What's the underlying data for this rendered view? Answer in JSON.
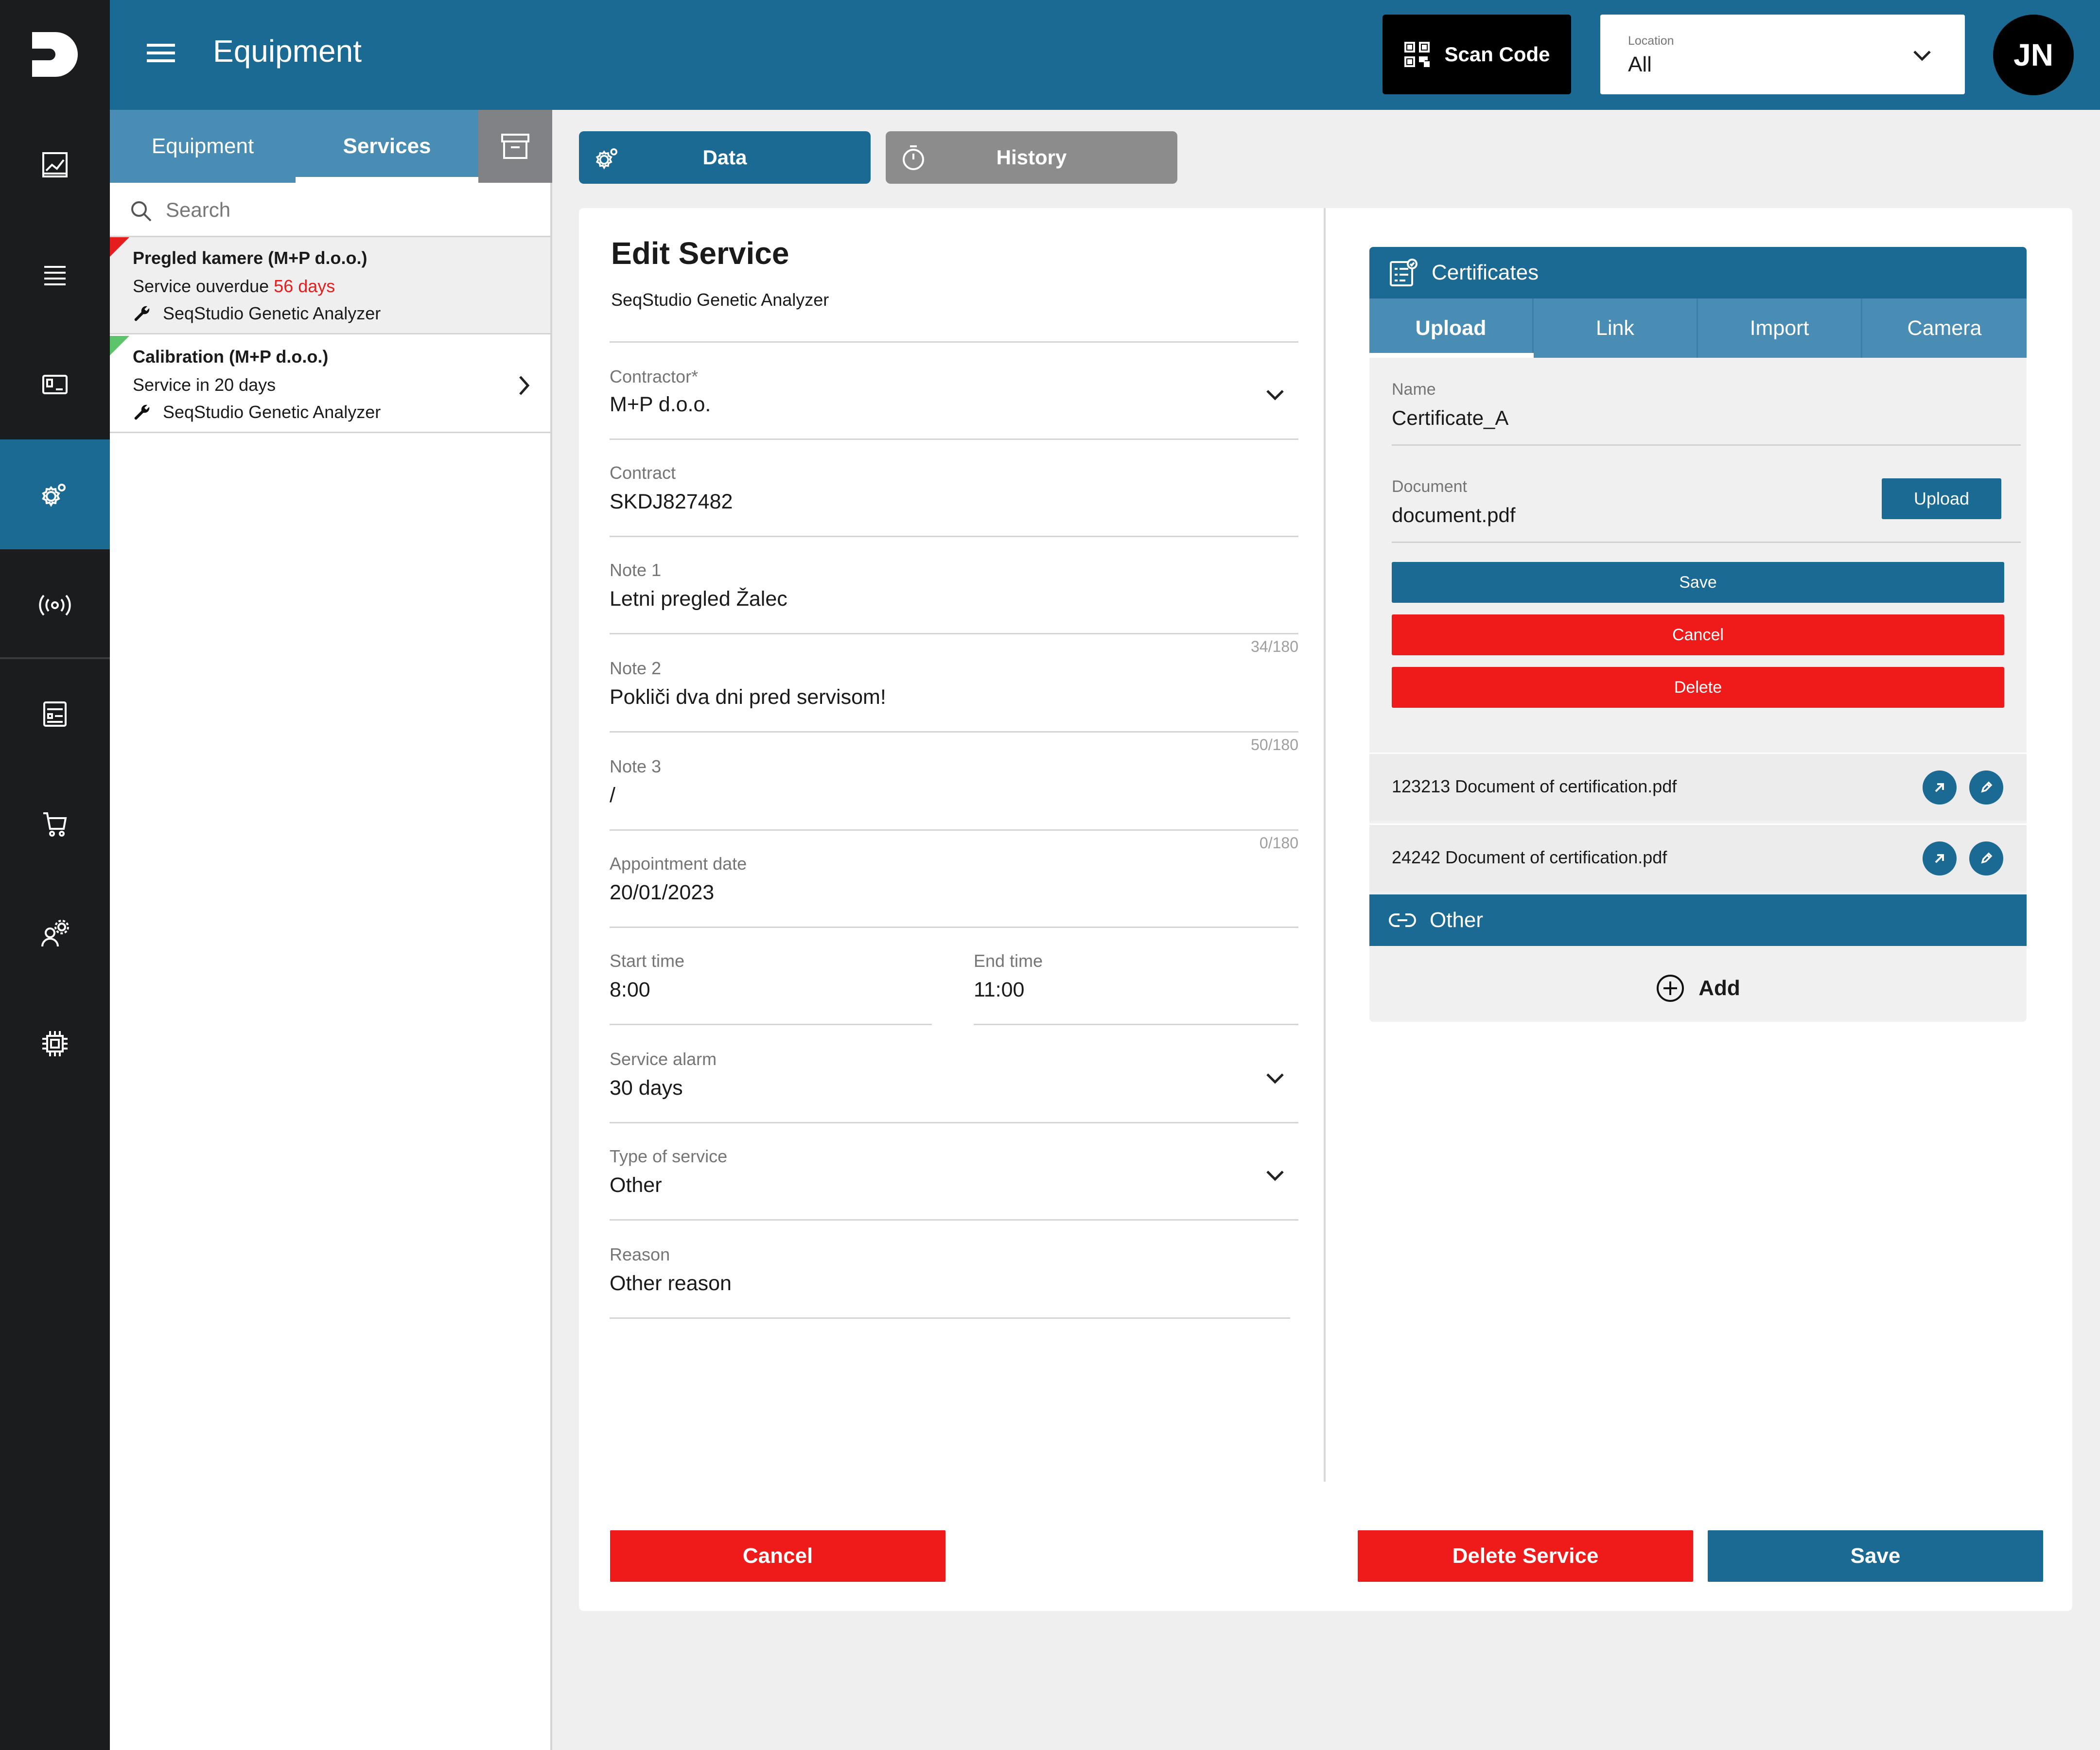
{
  "header": {
    "title": "Equipment",
    "scan_label": "Scan Code",
    "location_label": "Location",
    "location_value": "All",
    "avatar_initials": "JN"
  },
  "list": {
    "tabs": [
      "Equipment",
      "Services"
    ],
    "active_tab": "Services",
    "search_placeholder": "Search",
    "items": [
      {
        "title": "Pregled kamere (M+P d.o.o.)",
        "status_prefix": "Service ouverdue ",
        "status_highlight": "56 days",
        "device": "SeqStudio Genetic Analyzer",
        "corner_color": "#e51d1d"
      },
      {
        "title": "Calibration (M+P d.o.o.)",
        "status_prefix": "Service in 20 days",
        "status_highlight": "",
        "device": "SeqStudio Genetic Analyzer",
        "corner_color": "#5cc46a"
      }
    ]
  },
  "content_tabs": {
    "data": "Data",
    "history": "History"
  },
  "form": {
    "title": "Edit Service",
    "subtitle": "SeqStudio Genetic Analyzer",
    "contractor": {
      "label": "Contractor*",
      "value": "M+P d.o.o."
    },
    "contract": {
      "label": "Contract",
      "value": "SKDJ827482"
    },
    "note1": {
      "label": "Note 1",
      "value": "Letni pregled Žalec",
      "count": "34/180"
    },
    "note2": {
      "label": "Note 2",
      "value": "Pokliči dva dni pred servisom!",
      "count": "50/180"
    },
    "note3": {
      "label": "Note 3",
      "value": "/",
      "count": "0/180"
    },
    "appointment": {
      "label": "Appointment date",
      "value": "20/01/2023"
    },
    "start_time": {
      "label": "Start time",
      "value": "8:00"
    },
    "end_time": {
      "label": "End time",
      "value": "11:00"
    },
    "alarm": {
      "label": "Service alarm",
      "value": "30 days"
    },
    "type": {
      "label": "Type of service",
      "value": "Other"
    },
    "reason": {
      "label": "Reason",
      "value": "Other reason"
    },
    "cancel_label": "Cancel",
    "delete_label": "Delete Service",
    "save_label": "Save"
  },
  "certificates": {
    "title": "Certificates",
    "tabs": [
      "Upload",
      "Link",
      "Import",
      "Camera"
    ],
    "name_label": "Name",
    "name_value": "Certificate_A",
    "document_label": "Document",
    "document_value": "document.pdf",
    "upload_label": "Upload",
    "save_label": "Save",
    "cancel_label": "Cancel",
    "delete_label": "Delete",
    "documents": [
      "123213 Document of certification.pdf",
      "24242 Document of certification.pdf"
    ],
    "other_title": "Other",
    "add_label": "Add"
  },
  "colors": {
    "primary": "#1a6a93",
    "tab_bar": "#4a8db4",
    "danger": "#ef1b1b",
    "rail": "#1b1c1e"
  }
}
